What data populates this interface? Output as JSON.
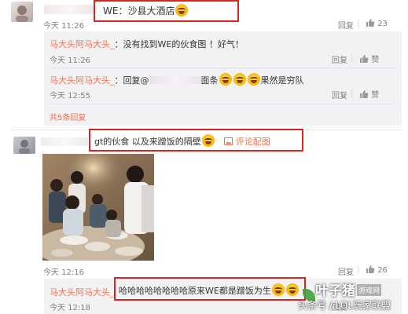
{
  "comment1": {
    "text": "WE：沙县大酒店",
    "time": "今天 11:26",
    "reply_label": "回复",
    "like_count": "23",
    "replies": [
      {
        "user": "马大头阿马大头_",
        "text": "：没有找到WE的伙食图 ！好气！",
        "time": "今天 11:26",
        "reply_label": "回复",
        "like_label": "赞"
      },
      {
        "user": "马大头阿马大头_",
        "text_prefix": "：回复@",
        "text_middle": "面条",
        "text_suffix": "果然是穷队",
        "time": "今天 12:55",
        "reply_label": "回复",
        "like_label": "赞"
      }
    ],
    "more_replies": "共5条回复"
  },
  "comment2": {
    "text": "gt的伙食 以及来蹭饭的隔壁",
    "image_link": "评论配图",
    "time": "今天 12:16",
    "reply_label": "回复",
    "like_count": "26",
    "replies": [
      {
        "user": "马大头阿马大头_",
        "text": "哈哈哈哈哈哈哈哈原来WE都是蹭饭为生",
        "time": "今天 12:18",
        "reply_label": "回复"
      }
    ]
  },
  "watermark": {
    "brand": "叶子猪",
    "brand_sub": "游戏网",
    "line2": "头条号 / LOL玩家联盟"
  },
  "icons": {
    "like": "thumbs-up-icon",
    "image": "picture-icon"
  },
  "colors": {
    "username": "#eb7350",
    "highlight_box": "#d9251d",
    "reply_bg": "#f2f2f5",
    "link": "#eb7350"
  }
}
